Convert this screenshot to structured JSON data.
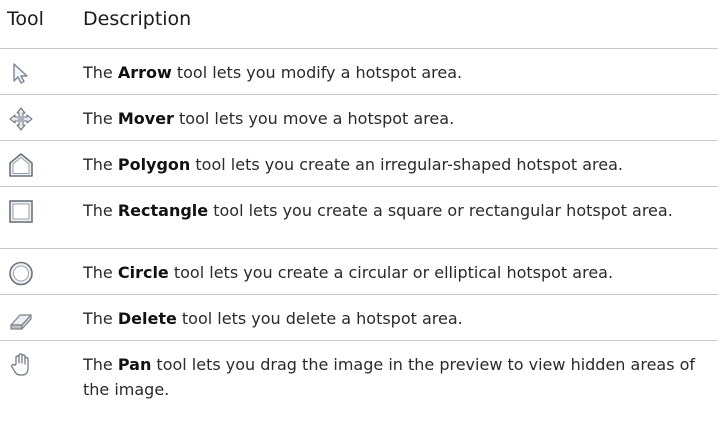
{
  "header": {
    "tool": "Tool",
    "description": "Description"
  },
  "rows": [
    {
      "icon": "arrow-icon",
      "pre": "The ",
      "name": "Arrow",
      "post": " tool lets you modify a hotspot area."
    },
    {
      "icon": "mover-icon",
      "pre": "The ",
      "name": "Mover",
      "post": " tool lets you move a hotspot area."
    },
    {
      "icon": "polygon-icon",
      "pre": "The ",
      "name": "Polygon",
      "post": " tool lets you create an irregular-shaped hotspot area."
    },
    {
      "icon": "rectangle-icon",
      "pre": "The ",
      "name": "Rectangle",
      "post": " tool lets you create a square or rectangular hotspot area."
    },
    {
      "icon": "circle-icon",
      "pre": "The ",
      "name": "Circle",
      "post": " tool lets you create a circular or elliptical hotspot area."
    },
    {
      "icon": "eraser-icon",
      "pre": "The ",
      "name": "Delete",
      "post": " tool lets you delete a hotspot area."
    },
    {
      "icon": "hand-icon",
      "pre": "The ",
      "name": "Pan",
      "post": " tool lets you drag the image in the preview to view hidden areas of the image."
    }
  ]
}
